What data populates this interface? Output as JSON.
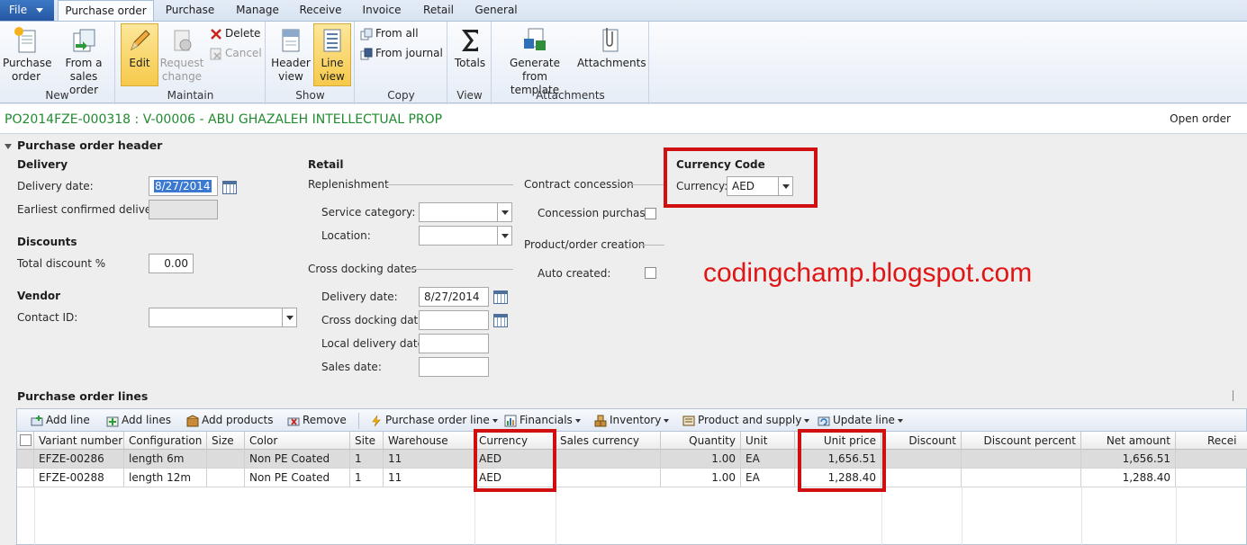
{
  "ribbon_tabs": [
    "File",
    "Purchase order",
    "Purchase",
    "Manage",
    "Receive",
    "Invoice",
    "Retail",
    "General"
  ],
  "ribbon": {
    "new": {
      "label": "New",
      "purchase_order": "Purchase order",
      "from_sales_order": "From a sales order"
    },
    "maintain": {
      "label": "Maintain",
      "edit": "Edit",
      "request_change": "Request change",
      "delete": "Delete",
      "cancel": "Cancel"
    },
    "show": {
      "label": "Show",
      "header_view": "Header view",
      "line_view": "Line view"
    },
    "copy": {
      "label": "Copy",
      "from_all": "From all",
      "from_journal": "From journal"
    },
    "view": {
      "label": "View",
      "totals": "Totals"
    },
    "attachments": {
      "label": "Attachments",
      "generate_from_template": "Generate from template",
      "attachments": "Attachments"
    }
  },
  "title": {
    "po": "PO2014FZE-000318 : V-00006 - ABU GHAZALEH INTELLECTUAL PROP",
    "status": "Open order"
  },
  "header": {
    "section_title": "Purchase order header",
    "delivery": {
      "title": "Delivery",
      "delivery_date_label": "Delivery date:",
      "delivery_date": "8/27/2014",
      "earliest_label": "Earliest confirmed delivery:",
      "earliest": ""
    },
    "discounts": {
      "title": "Discounts",
      "total_discount_label": "Total discount %",
      "total_discount": "0.00"
    },
    "vendor": {
      "title": "Vendor",
      "contact_id_label": "Contact ID:",
      "contact_id": ""
    },
    "retail": {
      "title": "Retail",
      "replenishment": "Replenishment",
      "service_category_label": "Service category:",
      "service_category": "",
      "location_label": "Location:",
      "location": ""
    },
    "cross_docking": {
      "title": "Cross docking dates",
      "delivery_date_label": "Delivery date:",
      "delivery_date": "8/27/2014",
      "cross_docking_date_label": "Cross docking date:",
      "local_delivery_date_label": "Local delivery date:",
      "sales_date_label": "Sales date:"
    },
    "contract": {
      "title": "Contract concession",
      "concession_purchase_label": "Concession purchase:"
    },
    "product_order": {
      "title": "Product/order creation",
      "auto_created_label": "Auto created:"
    },
    "currency_code": {
      "title": "Currency Code",
      "currency_label": "Currency:",
      "currency": "AED"
    }
  },
  "watermark": "codingchamp.blogspot.com",
  "lines": {
    "section_title": "Purchase order lines",
    "toolbar": [
      "Add line",
      "Add lines",
      "Add products",
      "Remove",
      "Purchase order line",
      "Financials",
      "Inventory",
      "Product and supply",
      "Update line"
    ],
    "columns": [
      "Variant number",
      "Configuration",
      "Size",
      "Color",
      "Site",
      "Warehouse",
      "Currency",
      "Sales currency",
      "Quantity",
      "Unit",
      "Unit price",
      "Discount",
      "Discount percent",
      "Net amount",
      "Recei"
    ],
    "rows": [
      [
        "EFZE-00286",
        "length 6m",
        "",
        "Non PE Coated",
        "1",
        "11",
        "AED",
        "",
        "1.00",
        "EA",
        "1,656.51",
        "",
        "",
        "1,656.51",
        ""
      ],
      [
        "EFZE-00288",
        "length 12m",
        "",
        "Non PE Coated",
        "1",
        "11",
        "AED",
        "",
        "1.00",
        "EA",
        "1,288.40",
        "",
        "",
        "1,288.40",
        ""
      ]
    ]
  },
  "colors": {
    "title_green": "#1f8b2f",
    "highlight_red": "#d01010",
    "file_blue": "#2557a3"
  }
}
